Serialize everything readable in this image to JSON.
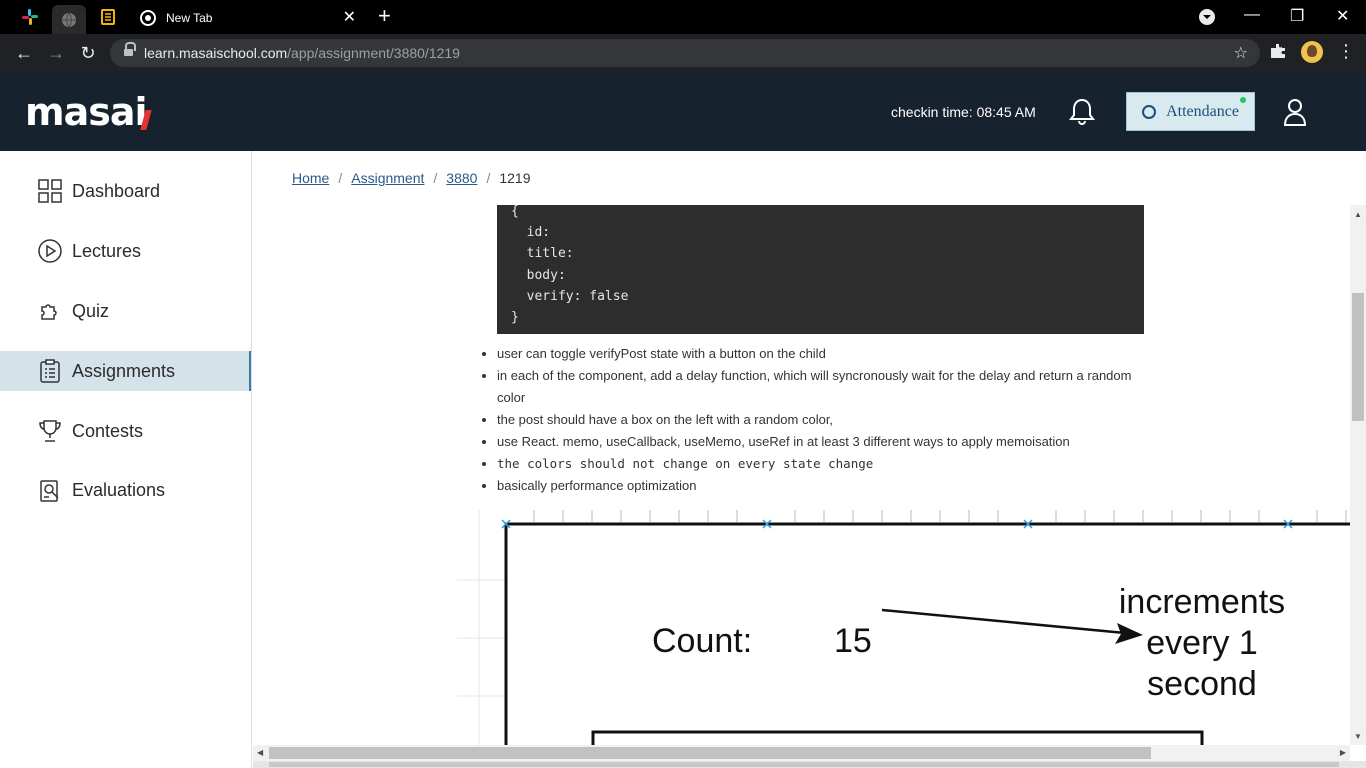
{
  "browser": {
    "tab_title": "New Tab",
    "url_host": "learn.masaischool.com",
    "url_path": "/app/assignment/3880/1219"
  },
  "header": {
    "logo_text": "masai",
    "checkin_label": "checkin time: 08:45 AM",
    "attendance_label": "Attendance"
  },
  "sidebar": {
    "items": [
      {
        "label": "Dashboard",
        "icon": "grid-icon"
      },
      {
        "label": "Lectures",
        "icon": "play-circle-icon"
      },
      {
        "label": "Quiz",
        "icon": "puzzle-icon"
      },
      {
        "label": "Assignments",
        "icon": "clipboard-icon",
        "active": true
      },
      {
        "label": "Contests",
        "icon": "trophy-icon"
      },
      {
        "label": "Evaluations",
        "icon": "evaluation-icon"
      }
    ]
  },
  "breadcrumb": {
    "home": "Home",
    "assignment": "Assignment",
    "id1": "3880",
    "id2": "1219",
    "sep": "/"
  },
  "code": {
    "lines": [
      "{",
      "  id:",
      "  title:",
      "  body:",
      "  verify: false",
      "}"
    ]
  },
  "bullets": [
    "user can toggle verifyPost state with a button on the child",
    "in each of the component, add a delay function, which will syncronously wait for the delay and return a random color",
    "the post should have a box on the left with a random color,",
    "use React. memo, useCallback, useMemo, useRef in at least 3 different ways to apply memoisation",
    "the colors should not change on every state change",
    "basically performance optimization"
  ],
  "diagram": {
    "count_label": "Count:",
    "count_value": "15",
    "note_line1": "increments",
    "note_line2": "every 1",
    "note_line3": "second"
  },
  "colors": {
    "appbar": "#17222f",
    "active_bg": "#d4e3e9",
    "link": "#2a5a8a"
  }
}
